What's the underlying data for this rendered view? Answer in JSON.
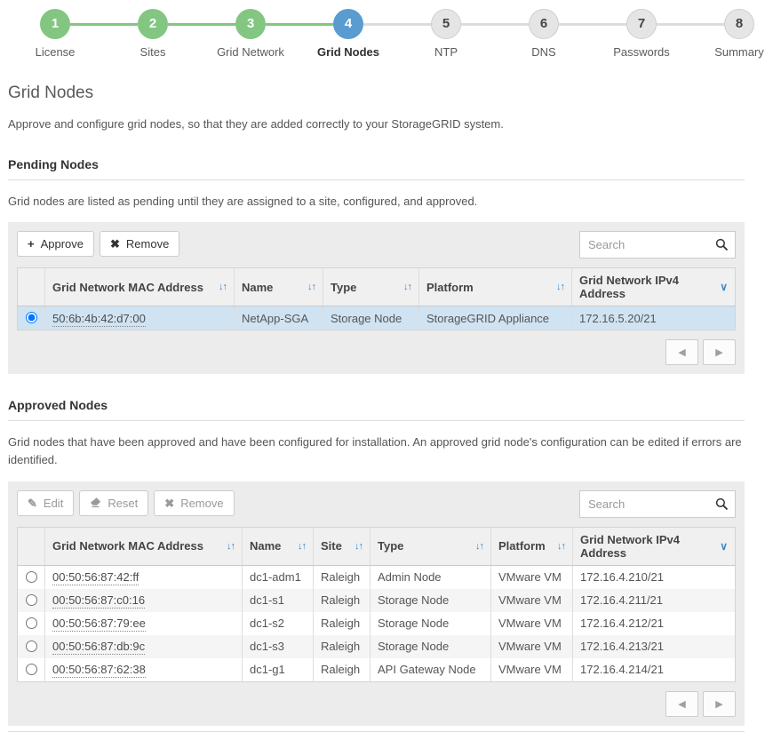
{
  "stepper": {
    "steps": [
      {
        "num": "1",
        "label": "License",
        "state": "completed"
      },
      {
        "num": "2",
        "label": "Sites",
        "state": "completed"
      },
      {
        "num": "3",
        "label": "Grid Network",
        "state": "completed"
      },
      {
        "num": "4",
        "label": "Grid Nodes",
        "state": "active"
      },
      {
        "num": "5",
        "label": "NTP",
        "state": "upcoming"
      },
      {
        "num": "6",
        "label": "DNS",
        "state": "upcoming"
      },
      {
        "num": "7",
        "label": "Passwords",
        "state": "upcoming"
      },
      {
        "num": "8",
        "label": "Summary",
        "state": "upcoming"
      }
    ]
  },
  "page": {
    "title": "Grid Nodes",
    "description": "Approve and configure grid nodes, so that they are added correctly to your StorageGRID system."
  },
  "pending": {
    "heading": "Pending Nodes",
    "description": "Grid nodes are listed as pending until they are assigned to a site, configured, and approved.",
    "toolbar": {
      "buttons": [
        {
          "label": "Approve",
          "icon": "plus-icon",
          "enabled": true
        },
        {
          "label": "Remove",
          "icon": "remove-icon",
          "enabled": true
        }
      ]
    },
    "search_placeholder": "Search",
    "columns": [
      {
        "label": "Grid Network MAC Address",
        "icon": "sort-icon"
      },
      {
        "label": "Name",
        "icon": "sort-icon"
      },
      {
        "label": "Type",
        "icon": "sort-icon"
      },
      {
        "label": "Platform",
        "icon": "sort-icon"
      },
      {
        "label": "Grid Network IPv4 Address",
        "icon": "chevron-down-icon"
      }
    ],
    "rows": [
      {
        "selected": true,
        "cells": [
          "50:6b:4b:42:d7:00",
          "NetApp-SGA",
          "Storage Node",
          "StorageGRID Appliance",
          "172.16.5.20/21"
        ]
      }
    ]
  },
  "approved": {
    "heading": "Approved Nodes",
    "description": "Grid nodes that have been approved and have been configured for installation. An approved grid node's configuration can be edited if errors are identified.",
    "toolbar": {
      "buttons": [
        {
          "label": "Edit",
          "icon": "pencil-icon",
          "enabled": false
        },
        {
          "label": "Reset",
          "icon": "eraser-icon",
          "enabled": false
        },
        {
          "label": "Remove",
          "icon": "remove-icon",
          "enabled": false
        }
      ]
    },
    "search_placeholder": "Search",
    "columns": [
      {
        "label": "Grid Network MAC Address",
        "icon": "sort-icon"
      },
      {
        "label": "Name",
        "icon": "sort-icon"
      },
      {
        "label": "Site",
        "icon": "sort-icon"
      },
      {
        "label": "Type",
        "icon": "sort-icon"
      },
      {
        "label": "Platform",
        "icon": "sort-icon"
      },
      {
        "label": "Grid Network IPv4 Address",
        "icon": "chevron-down-icon"
      }
    ],
    "rows": [
      {
        "selected": false,
        "cells": [
          "00:50:56:87:42:ff",
          "dc1-adm1",
          "Raleigh",
          "Admin Node",
          "VMware VM",
          "172.16.4.210/21"
        ]
      },
      {
        "selected": false,
        "cells": [
          "00:50:56:87:c0:16",
          "dc1-s1",
          "Raleigh",
          "Storage Node",
          "VMware VM",
          "172.16.4.211/21"
        ]
      },
      {
        "selected": false,
        "cells": [
          "00:50:56:87:79:ee",
          "dc1-s2",
          "Raleigh",
          "Storage Node",
          "VMware VM",
          "172.16.4.212/21"
        ]
      },
      {
        "selected": false,
        "cells": [
          "00:50:56:87:db:9c",
          "dc1-s3",
          "Raleigh",
          "Storage Node",
          "VMware VM",
          "172.16.4.213/21"
        ]
      },
      {
        "selected": false,
        "cells": [
          "00:50:56:87:62:38",
          "dc1-g1",
          "Raleigh",
          "API Gateway Node",
          "VMware VM",
          "172.16.4.214/21"
        ]
      }
    ]
  },
  "colors": {
    "step_completed": "#82c682",
    "step_active": "#5a9bd0",
    "sort_icon_blue": "#3a87c8",
    "selected_row": "#d0e3f2"
  }
}
